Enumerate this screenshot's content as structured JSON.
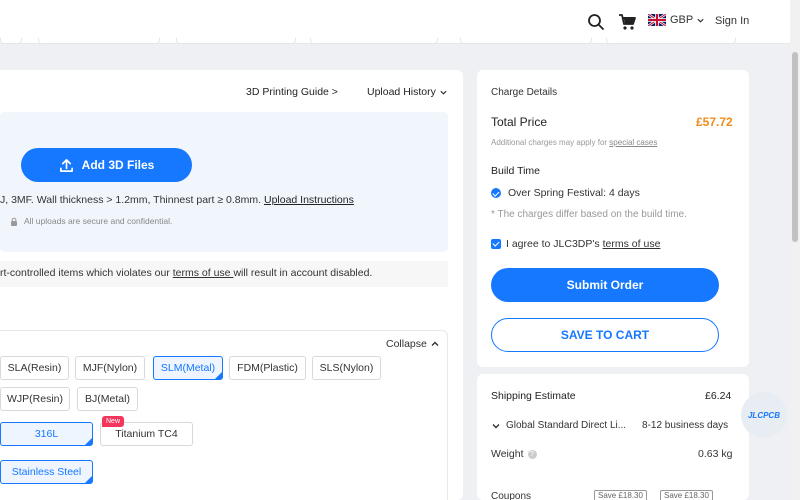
{
  "header": {
    "currency": "GBP",
    "sign_in": "Sign In"
  },
  "upload": {
    "guide_link": "3D Printing Guide >",
    "history_link": "Upload History",
    "add_button": "Add 3D Files",
    "formats_text": "J, 3MF. Wall thickness > 1.2mm, Thinnest part ≥ 0.8mm. ",
    "instructions_link": "Upload Instructions",
    "secure_text": "All uploads are secure and confidential."
  },
  "notice": {
    "text_before": "rt-controlled items which violates our ",
    "terms_link": "terms of use ",
    "text_after": "will result in account disabled."
  },
  "materials": {
    "collapse": "Collapse",
    "technologies": [
      "SLA(Resin)",
      "MJF(Nylon)",
      "SLM(Metal)",
      "FDM(Plastic)",
      "SLS(Nylon)",
      "WJP(Resin)",
      "BJ(Metal)"
    ],
    "selected_technology": "SLM(Metal)",
    "metals": [
      "316L",
      "Titanium TC4"
    ],
    "new_badge": "New",
    "finish": "Stainless Steel"
  },
  "charge": {
    "title": "Charge Details",
    "total_label": "Total Price",
    "total_value": "£57.72",
    "additional_before": "Additional charges may apply for ",
    "special_cases": "special cases",
    "build_time_label": "Build Time",
    "build_option": "Over Spring Festival: 4 days",
    "build_note": "* The charges differ based on the build time.",
    "agree_text": "I agree to JLC3DP's",
    "terms_link": "terms of use",
    "submit": "Submit Order",
    "cart": "SAVE TO CART"
  },
  "shipping": {
    "label": "Shipping Estimate",
    "value": "£6.24",
    "method": "Global Standard Direct Li...",
    "days": "8-12 business days",
    "weight_label": "Weight",
    "weight_value": "0.63 kg",
    "coupons_label": "Coupons",
    "coupon_tags": [
      "Save £18.30",
      "Save £18.30"
    ]
  },
  "widget": {
    "label": "JLCPCB"
  },
  "colors": {
    "primary": "#1677ff",
    "price": "#f08c1a",
    "new_badge": "#f5365c"
  }
}
